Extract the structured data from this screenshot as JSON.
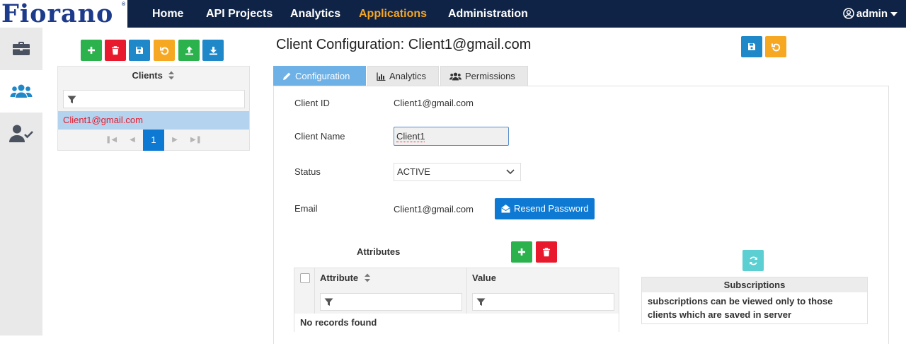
{
  "app": {
    "brand": "Fiorano",
    "brand_mark": "®"
  },
  "nav": {
    "items": [
      "Home",
      "API Projects",
      "Analytics",
      "Applications",
      "Administration"
    ],
    "active": "Applications",
    "user": "admin"
  },
  "sidebar": {
    "items": [
      {
        "name": "briefcase-icon"
      },
      {
        "name": "users-icon",
        "active": true
      },
      {
        "name": "user-check-icon"
      }
    ]
  },
  "clients_panel": {
    "header": "Clients",
    "rows": [
      "Client1@gmail.com"
    ],
    "selected_row": "Client1@gmail.com",
    "current_page": "1"
  },
  "main": {
    "title": "Client Configuration: Client1@gmail.com",
    "tabs": [
      {
        "label": "Configuration",
        "icon": "pencil-icon",
        "active": true
      },
      {
        "label": "Analytics",
        "icon": "bar-chart-icon"
      },
      {
        "label": "Permissions",
        "icon": "users-icon"
      }
    ],
    "form": {
      "client_id_label": "Client ID",
      "client_id_value": "Client1@gmail.com",
      "client_name_label": "Client Name",
      "client_name_value": "Client1",
      "status_label": "Status",
      "status_value": "ACTIVE",
      "email_label": "Email",
      "email_value": "Client1@gmail.com",
      "resend_label": "Resend Password"
    },
    "attributes": {
      "title": "Attributes",
      "columns": [
        "Attribute",
        "Value"
      ],
      "empty_text": "No records found"
    },
    "subscriptions": {
      "title": "Subscriptions",
      "message": "subscriptions can be viewed only to those clients which are saved in server"
    }
  },
  "colors": {
    "topbar": "#0f2346",
    "active_nav": "#f5a623",
    "green": "#2bb24c",
    "red": "#e8192c",
    "blue": "#1e88c9",
    "orange": "#f7a823",
    "primary": "#0d79d3",
    "selection": "#b3d3ee"
  }
}
